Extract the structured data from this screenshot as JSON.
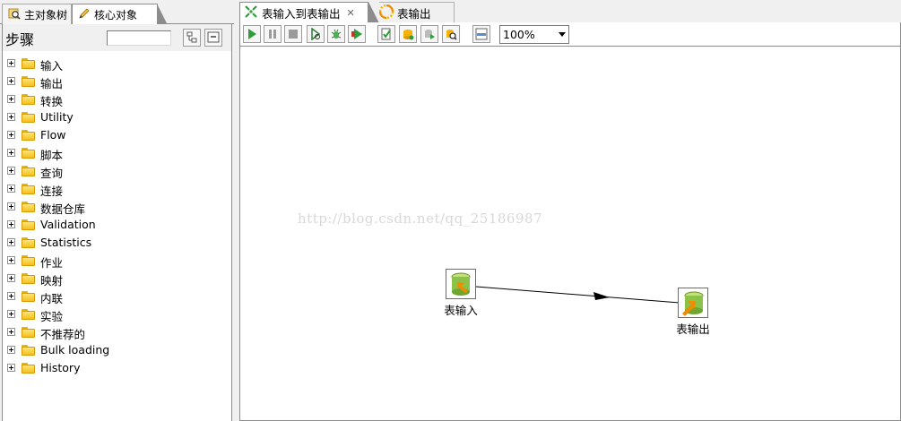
{
  "left_tabs": [
    {
      "label": "主对象树",
      "icon": "search-object-icon"
    },
    {
      "label": "核心对象",
      "icon": "pencil-icon"
    }
  ],
  "steps": {
    "title": "步骤",
    "search_value": "",
    "items": [
      {
        "label": "输入"
      },
      {
        "label": "输出"
      },
      {
        "label": "转换"
      },
      {
        "label": "Utility"
      },
      {
        "label": "Flow"
      },
      {
        "label": "脚本"
      },
      {
        "label": "查询"
      },
      {
        "label": "连接"
      },
      {
        "label": "数据仓库"
      },
      {
        "label": "Validation"
      },
      {
        "label": "Statistics"
      },
      {
        "label": "作业"
      },
      {
        "label": "映射"
      },
      {
        "label": "内联"
      },
      {
        "label": "实验"
      },
      {
        "label": "不推荐的"
      },
      {
        "label": "Bulk loading"
      },
      {
        "label": "History"
      }
    ]
  },
  "editor_tabs": [
    {
      "label": "表输入到表输出",
      "active": true,
      "closable": true
    },
    {
      "label": "表输出",
      "active": false,
      "closable": false
    }
  ],
  "toolbar": {
    "buttons": [
      "run-icon",
      "pause-icon",
      "stop-icon",
      "preview-icon",
      "debug-icon",
      "replay-icon",
      "verify-icon",
      "analyze-impact-icon",
      "sql-icon",
      "explore-db-icon",
      "toggle-results-icon"
    ],
    "zoom": "100%"
  },
  "canvas": {
    "watermark": "http://blog.csdn.net/qq_25186987",
    "nodes": [
      {
        "label": "表输入"
      },
      {
        "label": "表输出"
      }
    ],
    "accent_colors": {
      "db_green": "#8bc34a",
      "arrow_orange": "#f08c00"
    }
  }
}
